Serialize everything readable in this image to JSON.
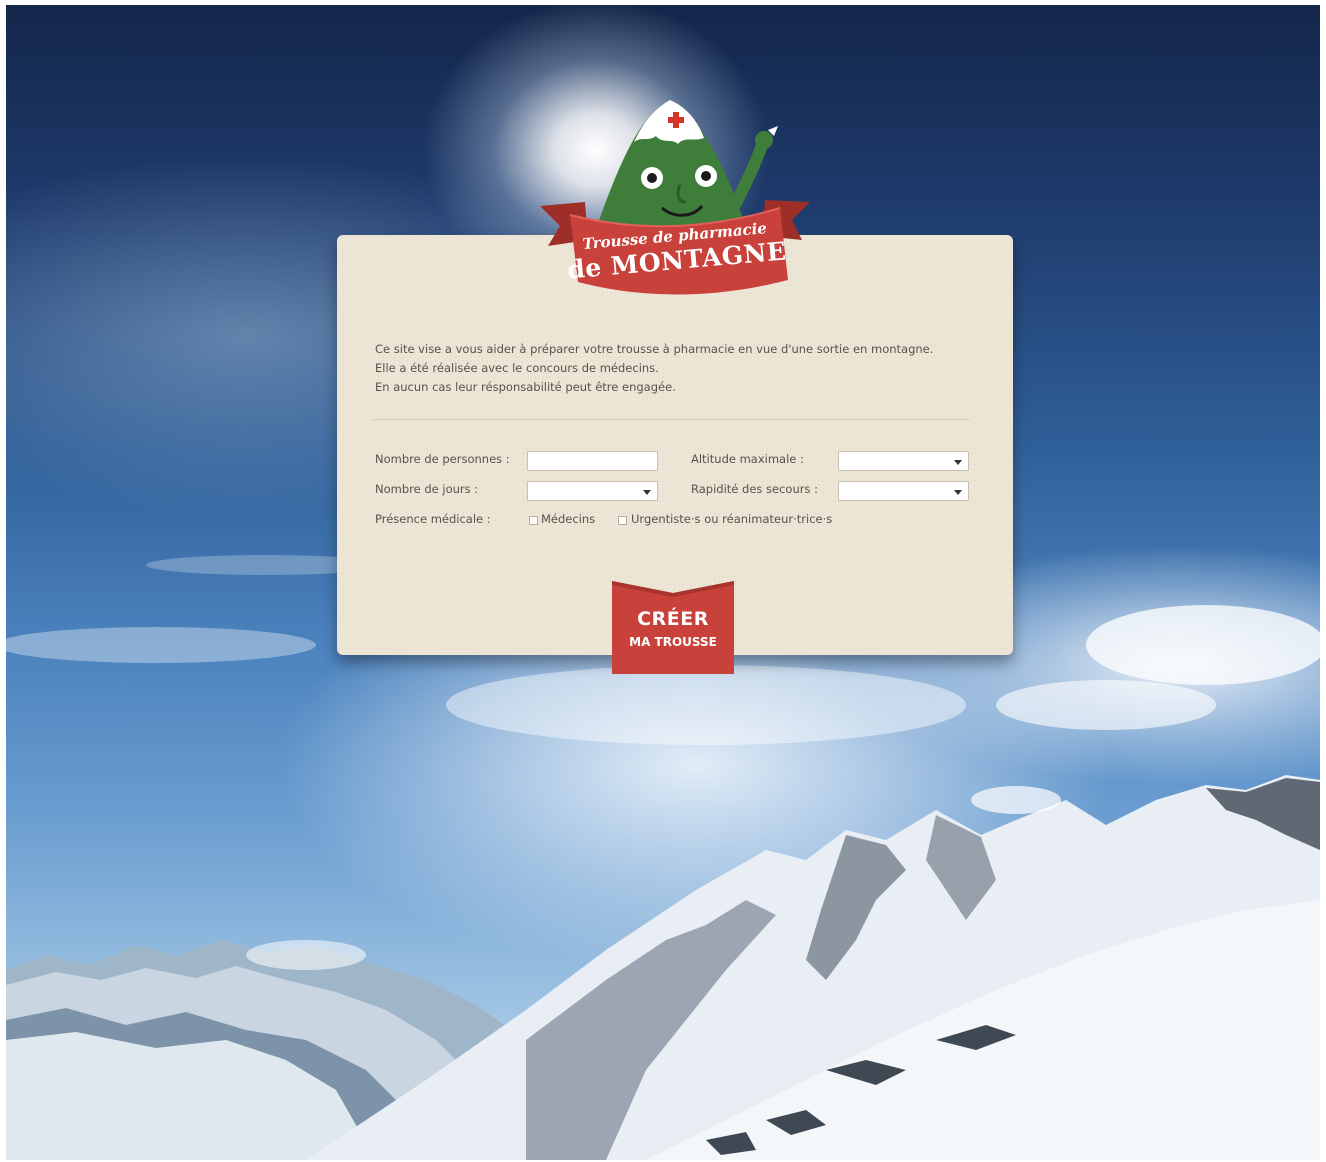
{
  "logo": {
    "line1": "Trousse de pharmacie",
    "line2": "de MONTAGNE"
  },
  "intro": {
    "line1": "Ce site vise a vous aider à préparer votre trousse à pharmacie en vue d'une sortie en montagne.",
    "line2": "Elle a été réalisée avec le concours de médecins.",
    "line3": "En aucun cas leur résponsabilité peut être engagée."
  },
  "form": {
    "persons_label": "Nombre de personnes :",
    "persons_value": "",
    "days_label": "Nombre de jours :",
    "days_value": "",
    "altitude_label": "Altitude maximale :",
    "altitude_value": "",
    "rescue_label": "Rapidité des secours :",
    "rescue_value": "",
    "medical_label": "Présence médicale :",
    "doctors_label": "Médecins",
    "emergency_label": "Urgentiste·s ou réanimateur·trice·s"
  },
  "create_button": {
    "line1": "CRÉER",
    "line2": "MA TROUSSE"
  },
  "colors": {
    "brand_red": "#c8413a",
    "card_bg": "#ede5d6",
    "mascot_green": "#3f7d3a"
  }
}
